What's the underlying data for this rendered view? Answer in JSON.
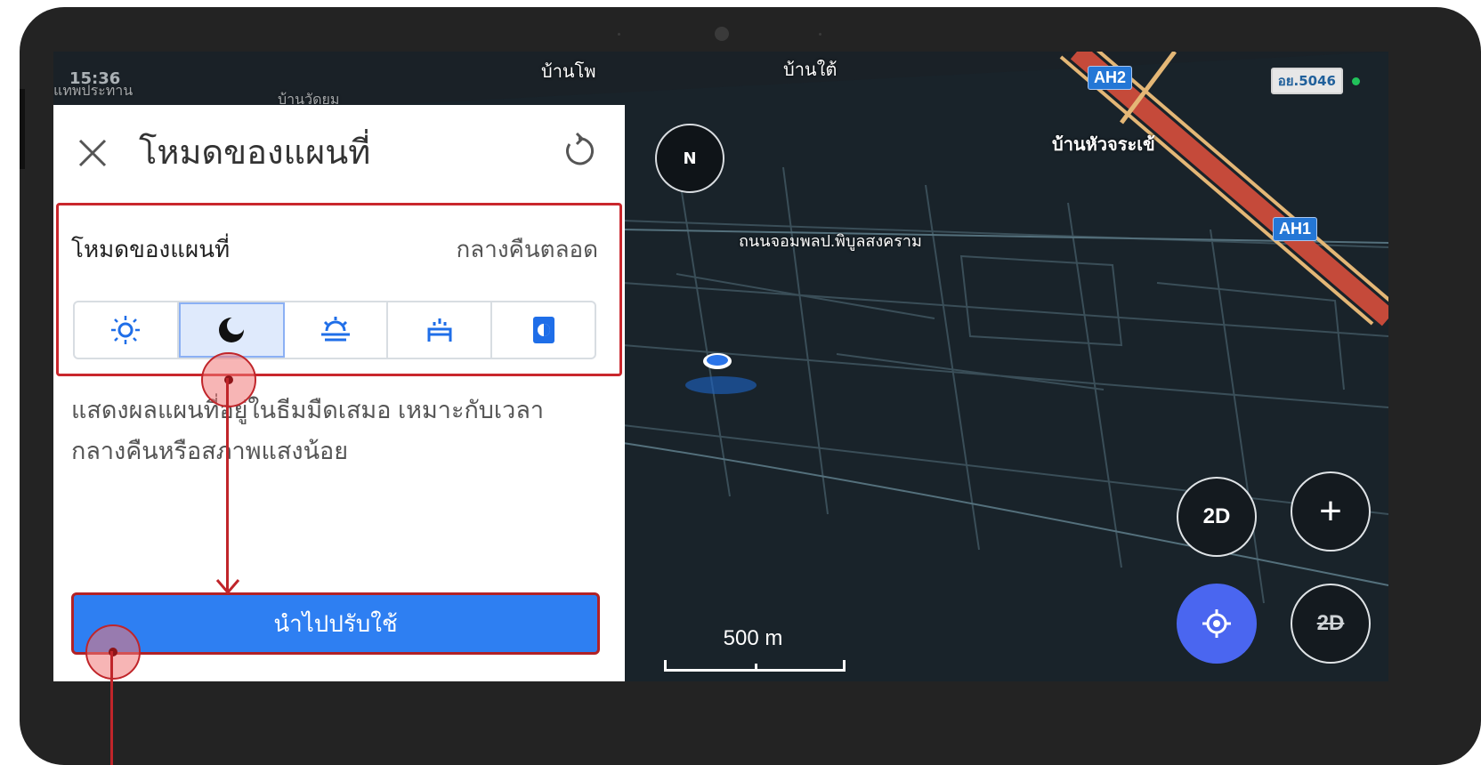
{
  "status": {
    "time": "15:36",
    "plate": "อย.5046"
  },
  "map": {
    "labels": [
      "บ้านโพ",
      "บ้านใต้",
      "บ้านหัวจระเข้",
      "ถนนจอมพลป.พิบูลสงคราม",
      "แทพประทาน",
      "บ้านวัดยม"
    ],
    "badges": [
      "AH2",
      "AH1"
    ],
    "compass": "N",
    "scale": "500 m",
    "btn_2d": "2D",
    "btn_zoom_in": "+",
    "btn_2d_disabled": "2D"
  },
  "panel": {
    "title": "โหมดของแผนที่",
    "mode_label": "โหมดของแผนที่",
    "mode_value": "กลางคืนตลอด",
    "modes": [
      "sun-icon",
      "moon-icon",
      "sunrise-icon",
      "sunset-icon",
      "auto-mode-icon"
    ],
    "selected_mode_index": 1,
    "description_line1": "แสดงผลแผนที่อยู่ในธีมมืดเสมอ เหมาะกับเวลา",
    "description_line2": "กลางคืนหรือสภาพแสงน้อย",
    "apply_label": "นำไปปรับใช้"
  },
  "colors": {
    "accent": "#2e7ff2",
    "highlight": "#c9262c",
    "map_bg": "#1b2228"
  }
}
